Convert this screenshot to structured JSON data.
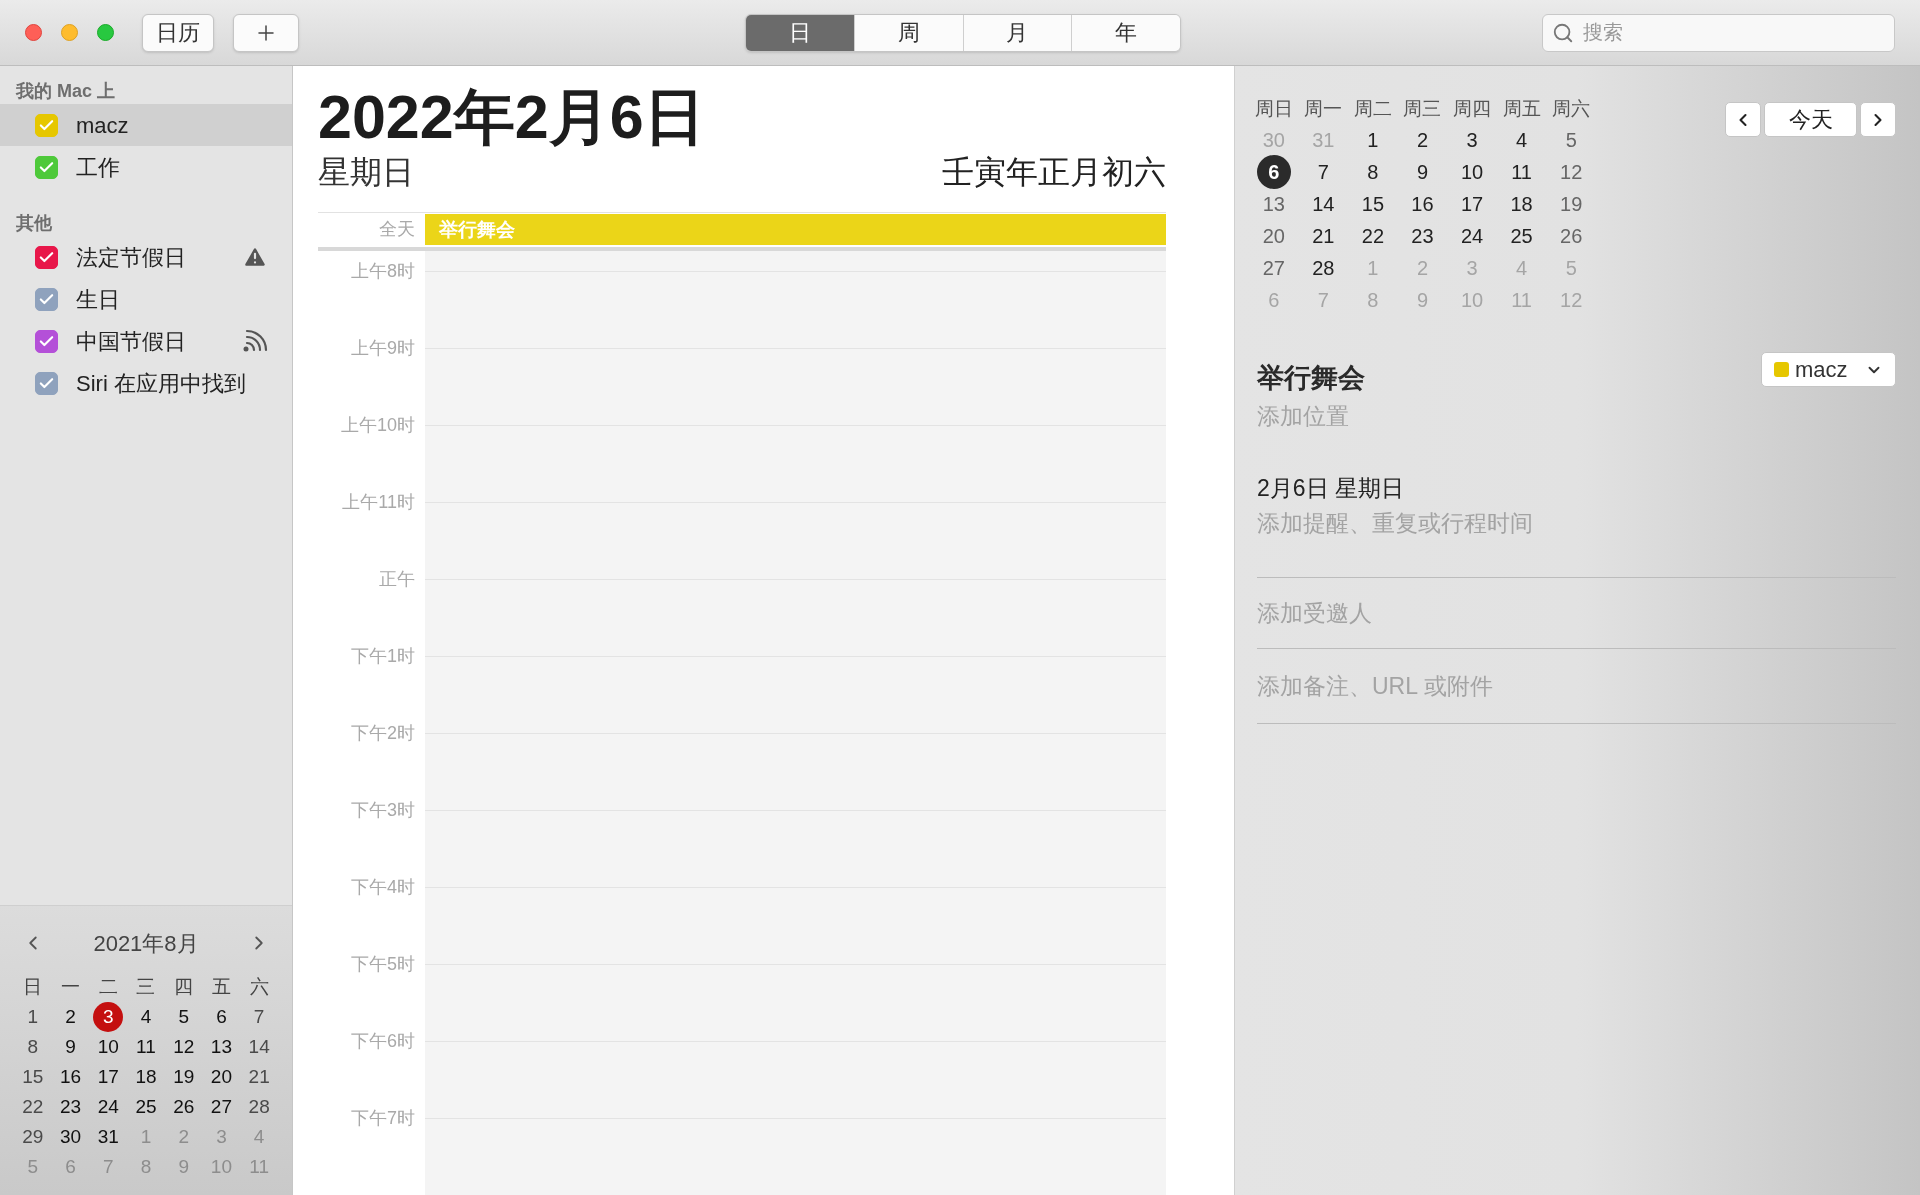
{
  "toolbar": {
    "calendars_button": "日历",
    "views": [
      {
        "label": "日",
        "selected": true
      },
      {
        "label": "周",
        "selected": false
      },
      {
        "label": "月",
        "selected": false
      },
      {
        "label": "年",
        "selected": false
      }
    ],
    "search": {
      "placeholder": "搜索"
    }
  },
  "sidebar": {
    "sections": [
      {
        "title": "我的 Mac 上",
        "calendars": [
          {
            "name": "macz",
            "color": "#e6c700",
            "checked": true,
            "selected": true
          },
          {
            "name": "工作",
            "color": "#4ec93a",
            "checked": true,
            "selected": false
          }
        ]
      },
      {
        "title": "其他",
        "calendars": [
          {
            "name": "法定节假日",
            "color": "#e8174a",
            "checked": true,
            "selected": false,
            "kind": "warning"
          },
          {
            "name": "生日",
            "color": "#8fa2bd",
            "checked": true,
            "selected": false
          },
          {
            "name": "中国节假日",
            "color": "#b450d8",
            "checked": true,
            "selected": false,
            "kind": "subscribed"
          },
          {
            "name": "Siri 在应用中找到",
            "color": "#8fa2bd",
            "checked": true,
            "selected": false
          }
        ]
      }
    ],
    "mini_calendar": {
      "month": "2021年8月",
      "weekdays": [
        "日",
        "一",
        "二",
        "三",
        "四",
        "五",
        "六"
      ],
      "days": [
        {
          "label": "1",
          "in_month": true,
          "today": false
        },
        {
          "label": "2",
          "in_month": true,
          "today": false
        },
        {
          "label": "3",
          "in_month": true,
          "today": true
        },
        {
          "label": "4",
          "in_month": true,
          "today": false
        },
        {
          "label": "5",
          "in_month": true,
          "today": false
        },
        {
          "label": "6",
          "in_month": true,
          "today": false
        },
        {
          "label": "7",
          "in_month": true,
          "today": false
        },
        {
          "label": "8",
          "in_month": true,
          "today": false
        },
        {
          "label": "9",
          "in_month": true,
          "today": false
        },
        {
          "label": "10",
          "in_month": true,
          "today": false
        },
        {
          "label": "11",
          "in_month": true,
          "today": false
        },
        {
          "label": "12",
          "in_month": true,
          "today": false
        },
        {
          "label": "13",
          "in_month": true,
          "today": false
        },
        {
          "label": "14",
          "in_month": true,
          "today": false
        },
        {
          "label": "15",
          "in_month": true,
          "today": false
        },
        {
          "label": "16",
          "in_month": true,
          "today": false
        },
        {
          "label": "17",
          "in_month": true,
          "today": false
        },
        {
          "label": "18",
          "in_month": true,
          "today": false
        },
        {
          "label": "19",
          "in_month": true,
          "today": false
        },
        {
          "label": "20",
          "in_month": true,
          "today": false
        },
        {
          "label": "21",
          "in_month": true,
          "today": false
        },
        {
          "label": "22",
          "in_month": true,
          "today": false
        },
        {
          "label": "23",
          "in_month": true,
          "today": false
        },
        {
          "label": "24",
          "in_month": true,
          "today": false
        },
        {
          "label": "25",
          "in_month": true,
          "today": false
        },
        {
          "label": "26",
          "in_month": true,
          "today": false
        },
        {
          "label": "27",
          "in_month": true,
          "today": false
        },
        {
          "label": "28",
          "in_month": true,
          "today": false
        },
        {
          "label": "29",
          "in_month": true,
          "today": false
        },
        {
          "label": "30",
          "in_month": true,
          "today": false
        },
        {
          "label": "31",
          "in_month": true,
          "today": false
        },
        {
          "label": "1",
          "in_month": false,
          "today": false
        },
        {
          "label": "2",
          "in_month": false,
          "today": false
        },
        {
          "label": "3",
          "in_month": false,
          "today": false
        },
        {
          "label": "4",
          "in_month": false,
          "today": false
        },
        {
          "label": "5",
          "in_month": false,
          "today": false
        },
        {
          "label": "6",
          "in_month": false,
          "today": false
        },
        {
          "label": "7",
          "in_month": false,
          "today": false
        },
        {
          "label": "8",
          "in_month": false,
          "today": false
        },
        {
          "label": "9",
          "in_month": false,
          "today": false
        },
        {
          "label": "10",
          "in_month": false,
          "today": false
        },
        {
          "label": "11",
          "in_month": false,
          "today": false
        }
      ]
    }
  },
  "day_view": {
    "date": "2022年2月6日",
    "weekday": "星期日",
    "lunar": "壬寅年正月初六",
    "all_day_label": "全天",
    "all_day_events": [
      {
        "title": "举行舞会",
        "color": "#ebd518"
      }
    ],
    "hours": [
      "上午8时",
      "上午9时",
      "上午10时",
      "上午11时",
      "正午",
      "下午1时",
      "下午2时",
      "下午3时",
      "下午4时",
      "下午5时",
      "下午6时",
      "下午7时"
    ]
  },
  "inspector": {
    "today_button": "今天",
    "weekdays": [
      "周日",
      "周一",
      "周二",
      "周三",
      "周四",
      "周五",
      "周六"
    ],
    "days": [
      {
        "label": "30",
        "in_month": false,
        "selected": false
      },
      {
        "label": "31",
        "in_month": false,
        "selected": false
      },
      {
        "label": "1",
        "in_month": true,
        "selected": false
      },
      {
        "label": "2",
        "in_month": true,
        "selected": false
      },
      {
        "label": "3",
        "in_month": true,
        "selected": false
      },
      {
        "label": "4",
        "in_month": true,
        "selected": false
      },
      {
        "label": "5",
        "in_month": true,
        "selected": false
      },
      {
        "label": "6",
        "in_month": true,
        "selected": true
      },
      {
        "label": "7",
        "in_month": true,
        "selected": false
      },
      {
        "label": "8",
        "in_month": true,
        "selected": false
      },
      {
        "label": "9",
        "in_month": true,
        "selected": false
      },
      {
        "label": "10",
        "in_month": true,
        "selected": false
      },
      {
        "label": "11",
        "in_month": true,
        "selected": false
      },
      {
        "label": "12",
        "in_month": true,
        "selected": false
      },
      {
        "label": "13",
        "in_month": true,
        "selected": false
      },
      {
        "label": "14",
        "in_month": true,
        "selected": false
      },
      {
        "label": "15",
        "in_month": true,
        "selected": false
      },
      {
        "label": "16",
        "in_month": true,
        "selected": false
      },
      {
        "label": "17",
        "in_month": true,
        "selected": false
      },
      {
        "label": "18",
        "in_month": true,
        "selected": false
      },
      {
        "label": "19",
        "in_month": true,
        "selected": false
      },
      {
        "label": "20",
        "in_month": true,
        "selected": false
      },
      {
        "label": "21",
        "in_month": true,
        "selected": false
      },
      {
        "label": "22",
        "in_month": true,
        "selected": false
      },
      {
        "label": "23",
        "in_month": true,
        "selected": false
      },
      {
        "label": "24",
        "in_month": true,
        "selected": false
      },
      {
        "label": "25",
        "in_month": true,
        "selected": false
      },
      {
        "label": "26",
        "in_month": true,
        "selected": false
      },
      {
        "label": "27",
        "in_month": true,
        "selected": false
      },
      {
        "label": "28",
        "in_month": true,
        "selected": false
      },
      {
        "label": "1",
        "in_month": false,
        "selected": false
      },
      {
        "label": "2",
        "in_month": false,
        "selected": false
      },
      {
        "label": "3",
        "in_month": false,
        "selected": false
      },
      {
        "label": "4",
        "in_month": false,
        "selected": false
      },
      {
        "label": "5",
        "in_month": false,
        "selected": false
      },
      {
        "label": "6",
        "in_month": false,
        "selected": false
      },
      {
        "label": "7",
        "in_month": false,
        "selected": false
      },
      {
        "label": "8",
        "in_month": false,
        "selected": false
      },
      {
        "label": "9",
        "in_month": false,
        "selected": false
      },
      {
        "label": "10",
        "in_month": false,
        "selected": false
      },
      {
        "label": "11",
        "in_month": false,
        "selected": false
      },
      {
        "label": "12",
        "in_month": false,
        "selected": false
      }
    ],
    "event": {
      "title": "举行舞会",
      "location_placeholder": "添加位置",
      "calendar": {
        "name": "macz",
        "color": "#e6c700"
      },
      "date": "2月6日 星期日",
      "time_placeholder": "添加提醒、重复或行程时间",
      "invitees_placeholder": "添加受邀人",
      "notes_placeholder": "添加备注、URL 或附件"
    }
  }
}
